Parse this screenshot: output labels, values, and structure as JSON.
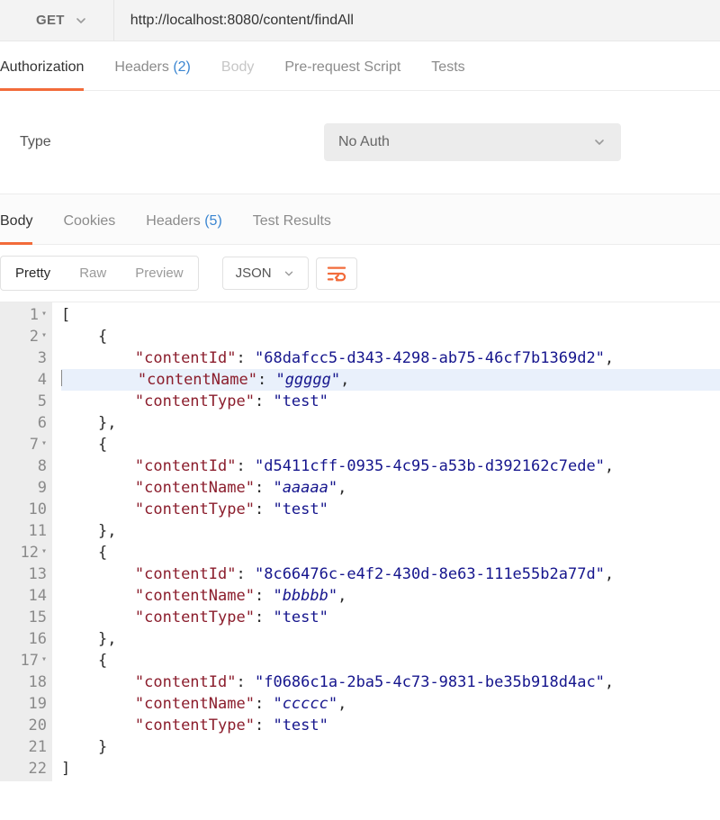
{
  "request": {
    "method": "GET",
    "url": "http://localhost:8080/content/findAll"
  },
  "reqTabs": {
    "authorization": "Authorization",
    "headers": "Headers",
    "headersCount": "(2)",
    "body": "Body",
    "prereq": "Pre-request Script",
    "tests": "Tests"
  },
  "auth": {
    "typeLabel": "Type",
    "selected": "No Auth"
  },
  "respTabs": {
    "body": "Body",
    "cookies": "Cookies",
    "headers": "Headers",
    "headersCount": "(5)",
    "testResults": "Test Results"
  },
  "bodyToolbar": {
    "pretty": "Pretty",
    "raw": "Raw",
    "preview": "Preview",
    "format": "JSON"
  },
  "responseJson": [
    {
      "contentId": "68dafcc5-d343-4298-ab75-46cf7b1369d2",
      "contentName": "ggggg",
      "contentType": "test"
    },
    {
      "contentId": "d5411cff-0935-4c95-a53b-d392162c7ede",
      "contentName": "aaaaa",
      "contentType": "test"
    },
    {
      "contentId": "8c66476c-e4f2-430d-8e63-111e55b2a77d",
      "contentName": "bbbbb",
      "contentType": "test"
    },
    {
      "contentId": "f0686c1a-2ba5-4c73-9831-be35b918d4ac",
      "contentName": "ccccc",
      "contentType": "test"
    }
  ],
  "editor": {
    "highlightedLine": 4,
    "foldableLines": [
      1,
      2,
      7,
      12,
      17
    ]
  }
}
